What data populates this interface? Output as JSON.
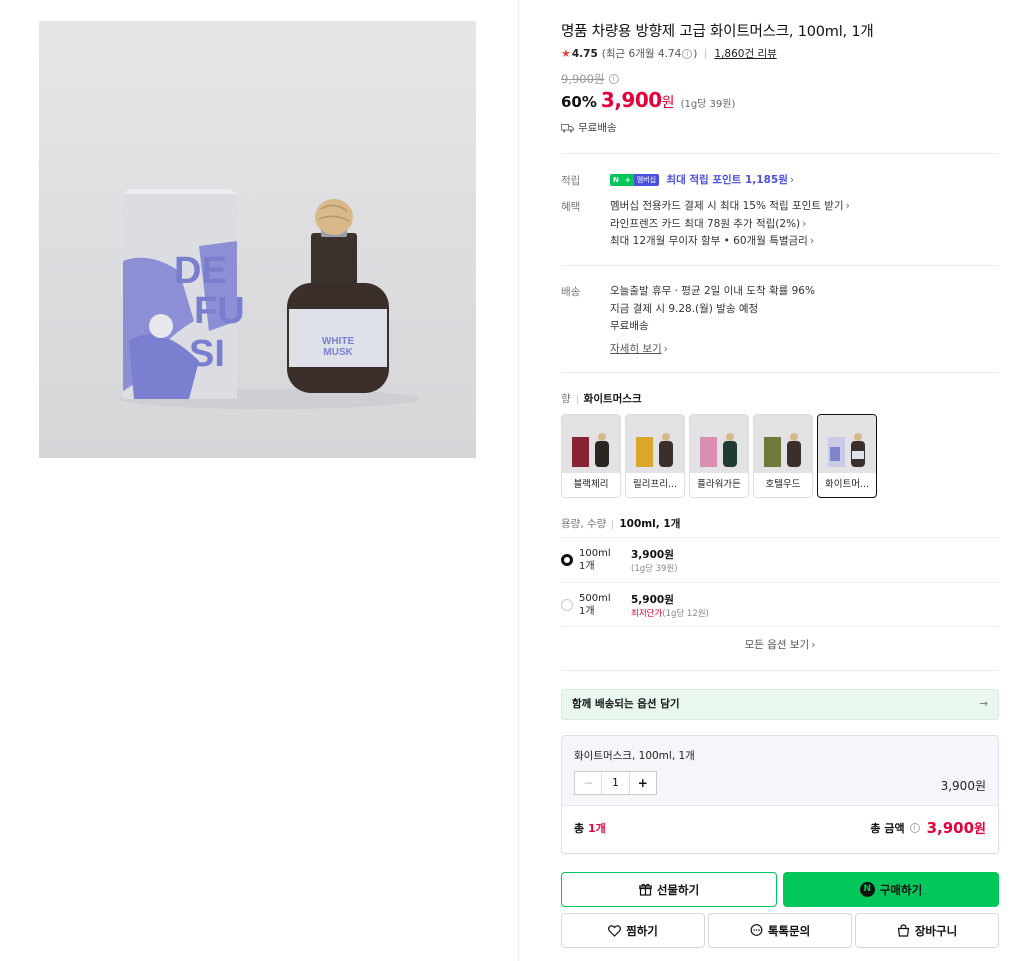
{
  "product": {
    "title": "명품 차량용 방향제 고급 화이트머스크, 100ml, 1개",
    "image_alt": "화이트머스크",
    "image_text": [
      "DE",
      "FU",
      "SI",
      "WHITE",
      "MUSK"
    ]
  },
  "rating": {
    "score": "4.75",
    "recent": "(최근 6개월 4.74",
    "recent_close": ")",
    "reviews": "1,860건 리뷰"
  },
  "price": {
    "original": "9,900원",
    "discount": "60%",
    "sale": "3,900",
    "won": "원",
    "unit_price": "(1g당 39원)",
    "shipping": "무료배송"
  },
  "benefits": {
    "points_label": "적립",
    "npay_n": "N",
    "npay_plus": "+",
    "npay_m": "멤버십",
    "points_text": "최대 적립 포인트 1,185원",
    "benefit_label": "혜택",
    "benefit_items": [
      "멤버십 전용카드 결제 시 최대 15% 적립 포인트 받기",
      "라인프렌즈 카드 최대 78원 추가 적립(2%)",
      "최대 12개월 무이자 할부 • 60개월 특별금리"
    ]
  },
  "delivery": {
    "label": "배송",
    "line1": "오늘출발 휴무 · 평균 2일 이내 도착 확률 96%",
    "line2": "지금 결제 시 9.28.(월) 발송 예정",
    "line3": "무료배송",
    "detail_link": "자세히 보기"
  },
  "scent": {
    "label": "향",
    "selected": "화이트머스크",
    "options": [
      {
        "name": "블랙체리",
        "color": "#8a2233"
      },
      {
        "name": "릴리프리지아",
        "name_shown": "릴리프리...",
        "color": "#d9a72a"
      },
      {
        "name": "플라워가든",
        "color": "#d98fb0"
      },
      {
        "name": "호텔우드",
        "color": "#6f7b3a"
      },
      {
        "name": "화이트머스크",
        "name_shown": "화이트머...",
        "color": "#7e86c9"
      }
    ]
  },
  "volume": {
    "label": "용량, 수량",
    "selected": "100ml, 1개",
    "options": [
      {
        "size": "100ml",
        "qty": "1개",
        "price": "3,900원",
        "sub_red": "",
        "sub": "(1g당 39원)",
        "checked": true
      },
      {
        "size": "500ml",
        "qty": "1개",
        "price": "5,900원",
        "sub_red": "최저단가",
        "sub": "(1g당 12원)",
        "checked": false
      }
    ],
    "all_options": "모든 옵션 보기"
  },
  "bundle": {
    "label": "함께 배송되는 옵션 담기",
    "arrow": "→"
  },
  "cart": {
    "item_name": "화이트머스크, 100ml, 1개",
    "minus": "−",
    "qty": "1",
    "plus": "+",
    "item_price": "3,900원",
    "total_prefix": "총 ",
    "total_count": "1개",
    "total_label": "총 금액",
    "total_price": "3,900",
    "total_won": "원"
  },
  "buttons": {
    "gift": "선물하기",
    "buy": "구매하기",
    "buy_logo": "N",
    "wish": "찜하기",
    "talk": "톡톡문의",
    "cart": "장바구니"
  },
  "colors": {
    "accent_red": "#e4003a",
    "naver_green": "#03c75a",
    "membership_purple": "#4b4fe0"
  }
}
